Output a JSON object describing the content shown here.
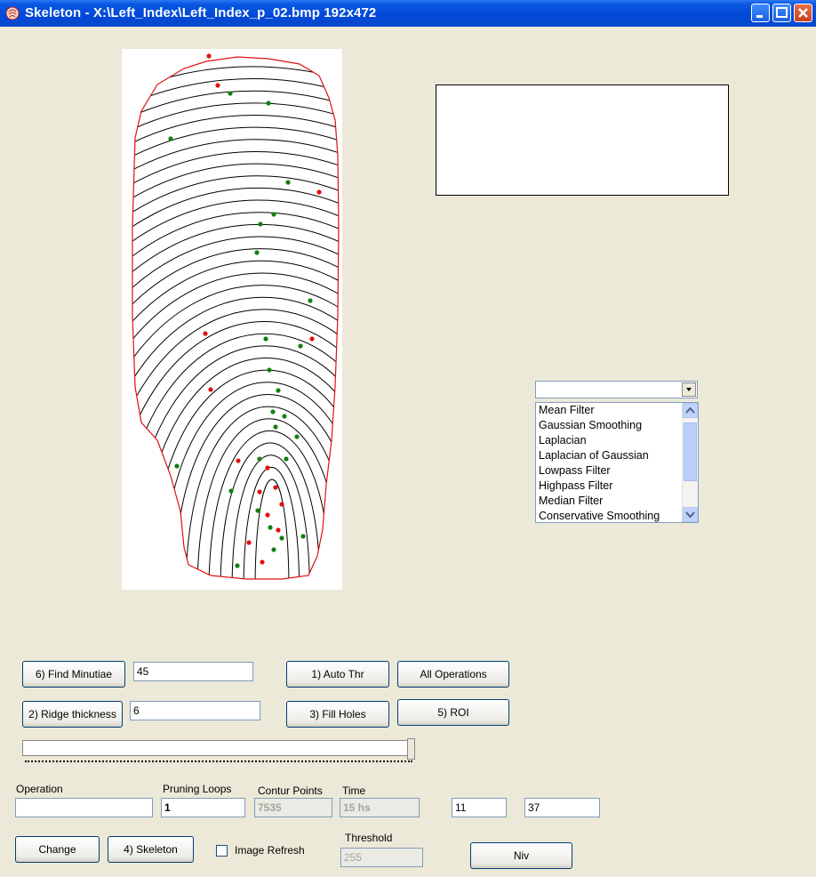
{
  "window": {
    "title": "Skeleton - X:\\Left_Index\\Left_Index_p_02.bmp 192x472"
  },
  "filters": {
    "combo_value": "",
    "items": [
      "Mean Filter",
      "Gaussian Smoothing",
      "Laplacian",
      "Laplacian of Gaussian",
      "Lowpass Filter",
      "Highpass Filter",
      "Median Filter",
      "Conservative Smoothing"
    ]
  },
  "controls": {
    "find_minutiae": {
      "label": "6) Find Minutiae",
      "value": "45"
    },
    "ridge_thickness": {
      "label": "2) Ridge thickness",
      "value": "6"
    },
    "auto_thr": "1) Auto Thr",
    "all_operations": "All Operations",
    "fill_holes": "3) Fill Holes",
    "roi": "5) ROI",
    "change": "Change",
    "skeleton": "4) Skeleton",
    "image_refresh": {
      "label": "Image Refresh",
      "checked": false
    },
    "niv": "Niv"
  },
  "status": {
    "operation": {
      "label": "Operation",
      "value": ""
    },
    "pruning_loops": {
      "label": "Pruning Loops",
      "value": "1"
    },
    "contur_points": {
      "label": "Contur Points",
      "value": "7535"
    },
    "time": {
      "label": "Time",
      "value": "15 hs"
    },
    "field_a": "11",
    "field_b": "37",
    "threshold": {
      "label": "Threshold",
      "value": "255"
    }
  },
  "colors": {
    "title_bar": "#0a58e0",
    "window_bg": "#ece9d8",
    "contour": "#e01010",
    "minutia_end": "#e01010",
    "minutia_bifurcation": "#108010"
  }
}
